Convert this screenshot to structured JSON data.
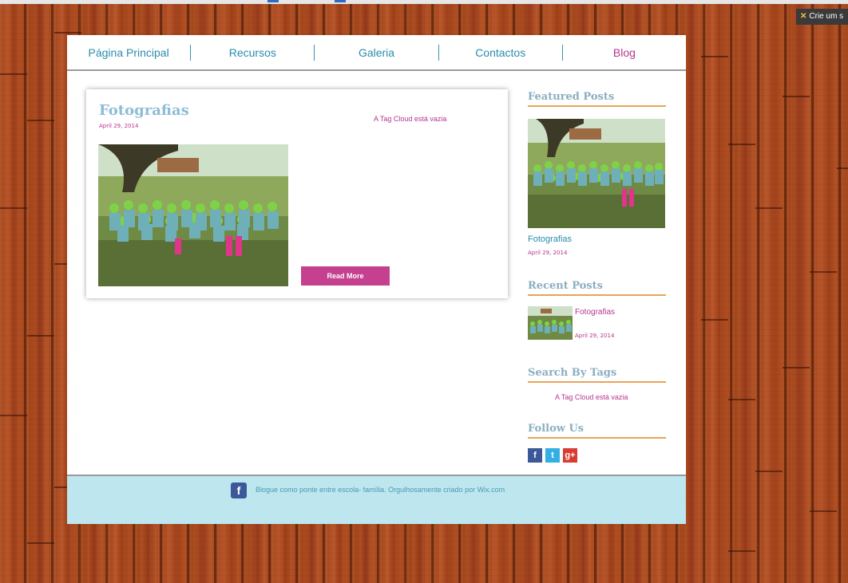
{
  "colors": {
    "nav_link": "#2a8cab",
    "nav_link_blog": "#b6358c",
    "accent_magenta": "#c5408f",
    "widget_rule": "#e8a35a",
    "footer_bg": "#bde6ef",
    "wood": "#a8491d"
  },
  "wix_badge": {
    "icon": "wix-x-icon",
    "label": "Crie um s"
  },
  "nav": {
    "items": [
      {
        "label": "Página Principal"
      },
      {
        "label": "Recursos"
      },
      {
        "label": "Galeria"
      },
      {
        "label": "Contactos"
      },
      {
        "label": "Blog"
      }
    ]
  },
  "post": {
    "title": "Fotografias",
    "date": "April 29, 2014",
    "tag_cloud_empty": "A Tag Cloud está vazia",
    "image": "photo-children-group-outdoors",
    "read_more": "Read More"
  },
  "sidebar": {
    "featured": {
      "heading": "Featured Posts",
      "image": "photo-children-group-outdoors",
      "post_title": "Fotografias",
      "post_date": "April 29, 2014"
    },
    "recent": {
      "heading": "Recent Posts",
      "post_title": "Fotografias",
      "post_date": "April 29, 2014"
    },
    "tags": {
      "heading": "Search By Tags",
      "empty": "A Tag Cloud está vazia"
    },
    "follow": {
      "heading": "Follow Us",
      "icons": [
        "facebook-icon",
        "twitter-icon",
        "google-plus-icon"
      ]
    }
  },
  "footer": {
    "icon": "facebook-icon",
    "text": "Blogue como ponte entre escola- família. Orgulhosamente criado por Wix.com"
  }
}
